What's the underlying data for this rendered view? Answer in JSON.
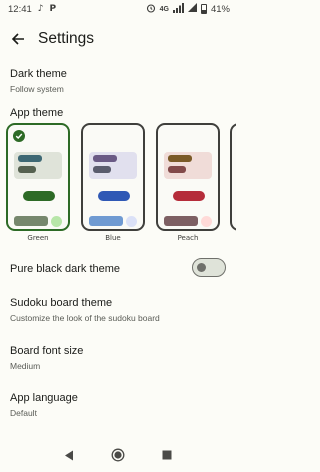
{
  "status_bar": {
    "time": "12:41",
    "network": "4G",
    "battery": "41%"
  },
  "app_bar": {
    "title": "Settings"
  },
  "settings": {
    "dark_theme": {
      "title": "Dark theme",
      "value": "Follow system"
    },
    "app_theme": {
      "title": "App theme"
    },
    "pure_black": {
      "title": "Pure black dark theme",
      "enabled": false
    },
    "sudoku_board_theme": {
      "title": "Sudoku board theme",
      "subtitle": "Customize the look of the sudoku board"
    },
    "board_font_size": {
      "title": "Board font size",
      "value": "Medium"
    },
    "app_language": {
      "title": "App language",
      "value": "Default"
    }
  },
  "themes": [
    {
      "label": "Green",
      "selected": true,
      "colors": {
        "frame": "#2d6a26",
        "block": "#dfe3d9",
        "pill_a": "#3e6874",
        "pill_b": "#566150",
        "button": "#2d6a26",
        "bar": "#76876d",
        "dot": "#b7e6a8"
      }
    },
    {
      "label": "Blue",
      "selected": false,
      "colors": {
        "frame": "#3f3f3c",
        "block": "#e1e0ee",
        "pill_a": "#6a5a85",
        "pill_b": "#5a5c6d",
        "button": "#2f58b5",
        "bar": "#6f9ad2",
        "dot": "#dbe1f7"
      }
    },
    {
      "label": "Peach",
      "selected": false,
      "colors": {
        "frame": "#3f3f3c",
        "block": "#f0dcd8",
        "pill_a": "#7a5a27",
        "pill_b": "#824a4a",
        "button": "#b52c3a",
        "bar": "#7d5f63",
        "dot": "#ffdad8"
      }
    }
  ]
}
